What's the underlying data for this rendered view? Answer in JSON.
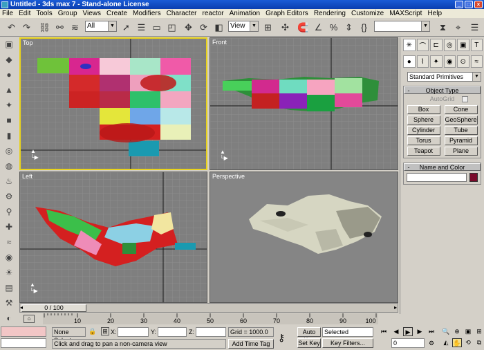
{
  "window": {
    "title": "Untitled - 3ds max 7 - Stand-alone License"
  },
  "menu": [
    "File",
    "Edit",
    "Tools",
    "Group",
    "Views",
    "Create",
    "Modifiers",
    "Character",
    "reactor",
    "Animation",
    "Graph Editors",
    "Rendering",
    "Customize",
    "MAXScript",
    "Help"
  ],
  "toolbar": {
    "selection_filter": "All",
    "ref_coord": "View",
    "named_selection": ""
  },
  "viewports": {
    "top": "Top",
    "front": "Front",
    "left": "Left",
    "perspective": "Perspective"
  },
  "command_panel": {
    "category": "Standard Primitives",
    "object_type_title": "Object Type",
    "autogrid": "AutoGrid",
    "objects": [
      "Box",
      "Cone",
      "Sphere",
      "GeoSphere",
      "Cylinder",
      "Tube",
      "Torus",
      "Pyramid",
      "Teapot",
      "Plane"
    ],
    "name_color_title": "Name and Color",
    "rollout_sign": "-"
  },
  "timeline": {
    "frame": "0 / 100",
    "ticks": [
      "10",
      "20",
      "30",
      "40",
      "50",
      "60",
      "70",
      "80",
      "90",
      "100"
    ]
  },
  "status": {
    "selection": "None Selecte",
    "x_label": "X:",
    "y_label": "Y:",
    "z_label": "Z:",
    "grid": "Grid = 1000.0",
    "prompt": "Click and drag to pan a non-camera view",
    "add_time_tag": "Add Time Tag",
    "auto_key": "Auto Key",
    "set_key": "Set Key",
    "key_mode": "Selected",
    "key_filters": "Key Filters...",
    "current_frame": "0"
  },
  "colors": {
    "active_viewport_border": "#e8d21a",
    "viewport_bg": "#7f7f7f",
    "title_bar": "#0a3fb0"
  }
}
